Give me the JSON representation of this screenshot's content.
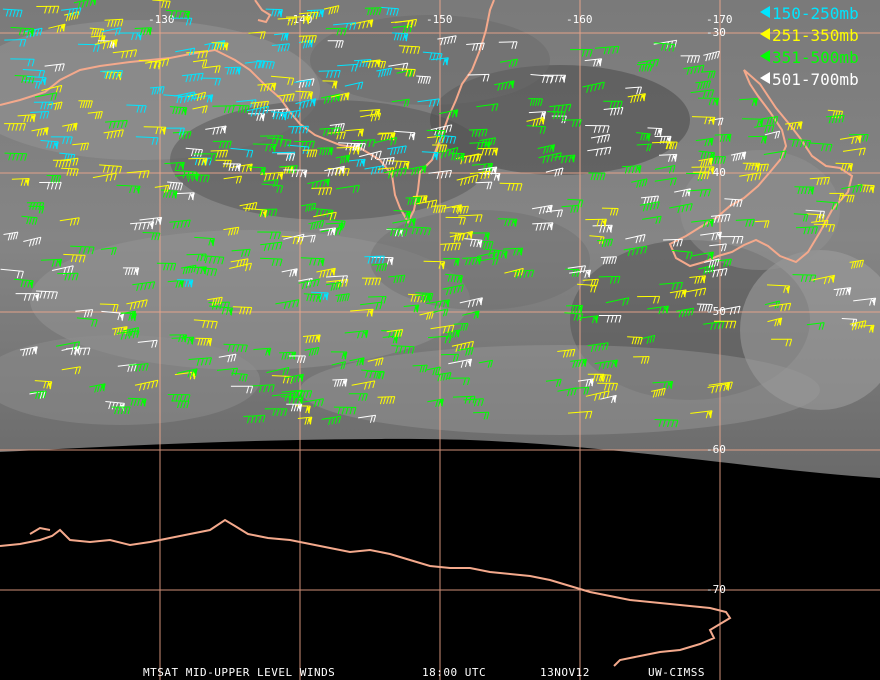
{
  "legend": {
    "items": [
      {
        "label": "150-250mb",
        "color": "#00e5ff"
      },
      {
        "label": "251-350mb",
        "color": "#ffff00"
      },
      {
        "label": "351-500mb",
        "color": "#00ff00"
      },
      {
        "label": "501-700mb",
        "color": "#ffffff"
      }
    ]
  },
  "grid": {
    "longitude_labels": [
      "-130",
      "-140",
      "-150",
      "-160",
      "-170"
    ],
    "latitude_labels": [
      "-30",
      "-40",
      "-50",
      "-60",
      "-70"
    ],
    "line_color": "#f4a98c"
  },
  "caption": {
    "product": "MTSAT MID-UPPER LEVEL WINDS",
    "time": "18:00 UTC",
    "date": "13NOV12",
    "source": "UW-CIMSS"
  },
  "colors": {
    "coastline": "#f4a98c",
    "imagery_light": "#8a8a8a",
    "imagery_dark": "#3a3a3a",
    "space": "#000000"
  }
}
